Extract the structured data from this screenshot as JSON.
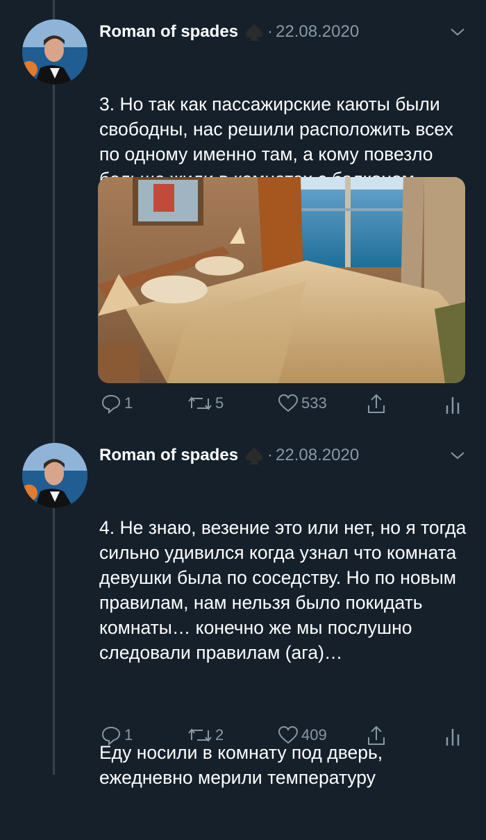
{
  "tweets": [
    {
      "author": "Roman of spades",
      "separator": "·",
      "date": "22.08.2020",
      "text": "3. Но так как пассажирские каюты были свободны, нас решили расположить всех по одному именно там, а кому повезло больше жили в комнатах с балконом.",
      "counts": {
        "replies": "1",
        "retweets": "5",
        "likes": "533"
      }
    },
    {
      "author": "Roman of spades",
      "separator": "·",
      "date": "22.08.2020",
      "text_lines": [
        "4. Не знаю, везение это или нет, но я тогда сильно удивился когда узнал что комната девушки была по соседству. Но по новым правилам, нам нельзя было покидать комнаты… конечно же мы послушно следовали правилам (ага)…",
        "Еду носили в комнату под дверь, ежедневно мерили температуру"
      ],
      "counts": {
        "replies": "1",
        "retweets": "2",
        "likes": "409"
      }
    }
  ],
  "icons": {
    "verified_like": "spade-icon",
    "menu": "chevron-down-icon",
    "reply": "reply-icon",
    "retweet": "retweet-icon",
    "like": "heart-icon",
    "share": "share-icon",
    "analytics": "analytics-icon"
  },
  "colors": {
    "background": "#15202b",
    "text": "#ffffff",
    "secondary": "#8899a6",
    "thread_line": "#38444d"
  }
}
